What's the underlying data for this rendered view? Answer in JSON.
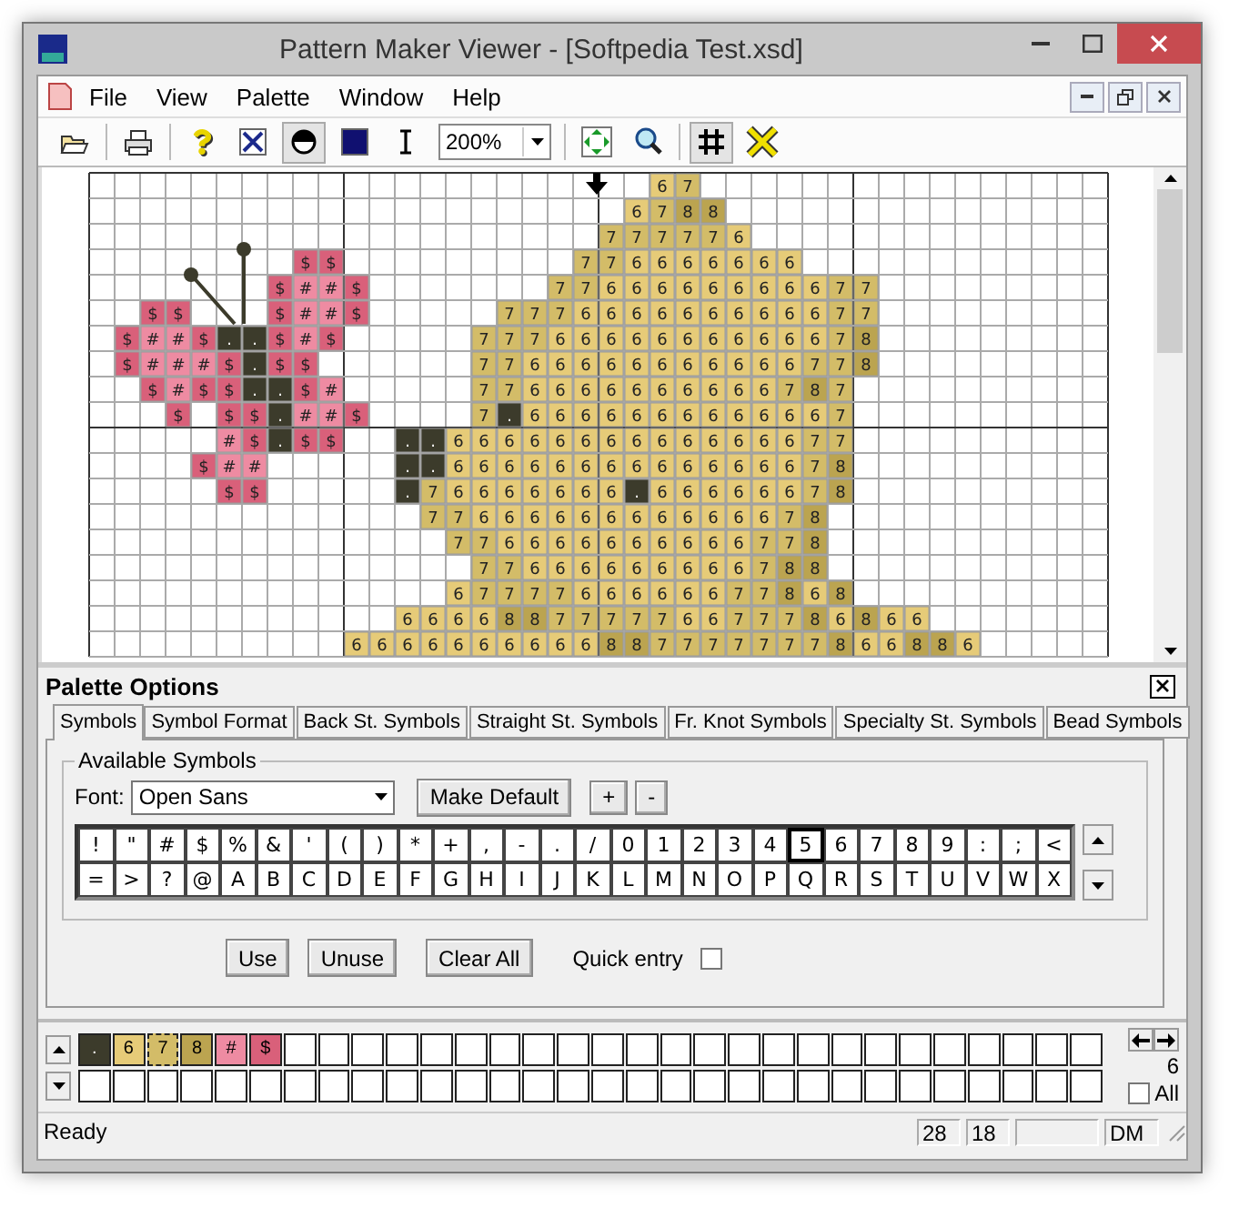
{
  "window": {
    "title": "Pattern Maker Viewer - [Softpedia Test.xsd]"
  },
  "menu": [
    "File",
    "View",
    "Palette",
    "Window",
    "Help"
  ],
  "toolbar": {
    "buttons": [
      {
        "pressed": false
      },
      {
        "pressed": false
      },
      {
        "pressed": false
      },
      {
        "pressed": false
      },
      {
        "pressed": true
      },
      {
        "pressed": false
      },
      {
        "pressed": false
      },
      {
        "pressed": false
      },
      {
        "pressed": false
      },
      {
        "pressed": true
      },
      {
        "pressed": false
      }
    ],
    "zoom": "200%"
  },
  "pattern": {
    "rows": [
      [
        null,
        null,
        null,
        null,
        null,
        null,
        null,
        null,
        null,
        null,
        null,
        null,
        null,
        null,
        null,
        null,
        null,
        null,
        null,
        null,
        null,
        null,
        "6",
        "7"
      ],
      [
        null,
        null,
        null,
        null,
        null,
        null,
        null,
        null,
        null,
        null,
        null,
        null,
        null,
        null,
        null,
        null,
        null,
        null,
        null,
        null,
        null,
        "6",
        "7",
        "8",
        "8"
      ],
      [
        null,
        null,
        null,
        null,
        null,
        null,
        null,
        null,
        null,
        null,
        null,
        null,
        null,
        null,
        null,
        null,
        null,
        null,
        null,
        null,
        "7",
        "7",
        "7",
        "7",
        "7",
        "6"
      ],
      [
        null,
        null,
        null,
        null,
        null,
        null,
        null,
        null,
        "$",
        "$",
        null,
        null,
        null,
        null,
        null,
        null,
        null,
        null,
        null,
        "7",
        "7",
        "6",
        "6",
        "6",
        "6",
        "6",
        "6",
        "6"
      ],
      [
        null,
        null,
        null,
        null,
        null,
        null,
        null,
        "$",
        "#",
        "#",
        "$",
        null,
        null,
        null,
        null,
        null,
        null,
        null,
        "7",
        "7",
        "6",
        "6",
        "6",
        "6",
        "6",
        "6",
        "6",
        "6",
        "6",
        "7",
        "7"
      ],
      [
        null,
        null,
        "$",
        "$",
        null,
        null,
        null,
        "$",
        "#",
        "#",
        "$",
        null,
        null,
        null,
        null,
        null,
        "7",
        "7",
        "7",
        "6",
        "6",
        "6",
        "6",
        "6",
        "6",
        "6",
        "6",
        "6",
        "6",
        "7",
        "7"
      ],
      [
        null,
        "$",
        "#",
        "#",
        "$",
        ".",
        ".",
        "$",
        "#",
        "$",
        null,
        null,
        null,
        null,
        null,
        "7",
        "7",
        "7",
        "6",
        "6",
        "6",
        "6",
        "6",
        "6",
        "6",
        "6",
        "6",
        "6",
        "6",
        "7",
        "8"
      ],
      [
        null,
        "$",
        "#",
        "#",
        "#",
        "$",
        ".",
        "$",
        "$",
        null,
        null,
        null,
        null,
        null,
        null,
        "7",
        "7",
        "6",
        "6",
        "6",
        "6",
        "6",
        "6",
        "6",
        "6",
        "6",
        "6",
        "6",
        "7",
        "7",
        "8"
      ],
      [
        null,
        null,
        "$",
        "#",
        "$",
        "$",
        ".",
        ".",
        "$",
        "#",
        null,
        null,
        null,
        null,
        null,
        "7",
        "7",
        "6",
        "6",
        "6",
        "6",
        "6",
        "6",
        "6",
        "6",
        "6",
        "6",
        "7",
        "8",
        "7"
      ],
      [
        null,
        null,
        null,
        "$",
        null,
        "$",
        "$",
        ".",
        "#",
        "#",
        "$",
        null,
        null,
        null,
        null,
        "7",
        ".",
        "6",
        "6",
        "6",
        "6",
        "6",
        "6",
        "6",
        "6",
        "6",
        "6",
        "6",
        "6",
        "7"
      ],
      [
        null,
        null,
        null,
        null,
        null,
        "#",
        "$",
        ".",
        "$",
        "$",
        null,
        null,
        ".",
        ".",
        "6",
        "6",
        "6",
        "6",
        "6",
        "6",
        "6",
        "6",
        "6",
        "6",
        "6",
        "6",
        "6",
        "6",
        "7",
        "7"
      ],
      [
        null,
        null,
        null,
        null,
        "$",
        "#",
        "#",
        null,
        null,
        null,
        null,
        null,
        ".",
        ".",
        "6",
        "6",
        "6",
        "6",
        "6",
        "6",
        "6",
        "6",
        "6",
        "6",
        "6",
        "6",
        "6",
        "6",
        "7",
        "8"
      ],
      [
        null,
        null,
        null,
        null,
        null,
        "$",
        "$",
        null,
        null,
        null,
        null,
        null,
        ".",
        "7",
        "6",
        "6",
        "6",
        "6",
        "6",
        "6",
        "6",
        ".",
        "6",
        "6",
        "6",
        "6",
        "6",
        "6",
        "7",
        "8"
      ],
      [
        null,
        null,
        null,
        null,
        null,
        null,
        null,
        null,
        null,
        null,
        null,
        null,
        null,
        "7",
        "7",
        "6",
        "6",
        "6",
        "6",
        "6",
        "6",
        "6",
        "6",
        "6",
        "6",
        "6",
        "6",
        "7",
        "8"
      ],
      [
        null,
        null,
        null,
        null,
        null,
        null,
        null,
        null,
        null,
        null,
        null,
        null,
        null,
        null,
        "7",
        "7",
        "6",
        "6",
        "6",
        "6",
        "6",
        "6",
        "6",
        "6",
        "6",
        "6",
        "7",
        "7",
        "8"
      ],
      [
        null,
        null,
        null,
        null,
        null,
        null,
        null,
        null,
        null,
        null,
        null,
        null,
        null,
        null,
        null,
        "7",
        "7",
        "6",
        "6",
        "6",
        "6",
        "6",
        "6",
        "6",
        "6",
        "6",
        "7",
        "8",
        "8"
      ],
      [
        null,
        null,
        null,
        null,
        null,
        null,
        null,
        null,
        null,
        null,
        null,
        null,
        null,
        null,
        "6",
        "7",
        "7",
        "7",
        "7",
        "6",
        "6",
        "6",
        "6",
        "6",
        "6",
        "7",
        "7",
        "8",
        "6",
        "8"
      ],
      [
        null,
        null,
        null,
        null,
        null,
        null,
        null,
        null,
        null,
        null,
        null,
        null,
        "6",
        "6",
        "6",
        "6",
        "8",
        "8",
        "7",
        "7",
        "7",
        "7",
        "7",
        "6",
        "6",
        "7",
        "7",
        "7",
        "8",
        "6",
        "8",
        "6",
        "6"
      ],
      [
        null,
        null,
        null,
        null,
        null,
        null,
        null,
        null,
        null,
        null,
        "6",
        "6",
        "6",
        "6",
        "6",
        "6",
        "6",
        "6",
        "6",
        "6",
        "8",
        "8",
        "7",
        "7",
        "7",
        "7",
        "7",
        "7",
        "7",
        "8",
        "6",
        "6",
        "8",
        "8",
        "6"
      ]
    ]
  },
  "palette_options": {
    "title": "Palette Options",
    "tabs": [
      {
        "label": "Symbols",
        "selected": true
      },
      {
        "label": "Symbol Format",
        "selected": false
      },
      {
        "label": "Back St. Symbols",
        "selected": false
      },
      {
        "label": "Straight St. Symbols",
        "selected": false
      },
      {
        "label": "Fr. Knot Symbols",
        "selected": false
      },
      {
        "label": "Specialty St. Symbols",
        "selected": false
      },
      {
        "label": "Bead Symbols",
        "selected": false
      }
    ],
    "group_title": "Available Symbols",
    "font_label": "Font:",
    "font_value": "Open Sans",
    "make_default": "Make Default",
    "size_buttons": [
      "+",
      "-"
    ],
    "symbols": [
      [
        {
          "s": "!",
          "selected": false
        },
        {
          "s": "\"",
          "selected": false
        },
        {
          "s": "#",
          "selected": false
        },
        {
          "s": "$",
          "selected": false
        },
        {
          "s": "%",
          "selected": false
        },
        {
          "s": "&",
          "selected": false
        },
        {
          "s": "'",
          "selected": false
        },
        {
          "s": "(",
          "selected": false
        },
        {
          "s": ")",
          "selected": false
        },
        {
          "s": "*",
          "selected": false
        },
        {
          "s": "+",
          "selected": false
        },
        {
          "s": ",",
          "selected": false
        },
        {
          "s": "-",
          "selected": false
        },
        {
          "s": ".",
          "selected": false
        },
        {
          "s": "/",
          "selected": false
        },
        {
          "s": "0",
          "selected": false
        },
        {
          "s": "1",
          "selected": false
        },
        {
          "s": "2",
          "selected": false
        },
        {
          "s": "3",
          "selected": false
        },
        {
          "s": "4",
          "selected": false
        },
        {
          "s": "5",
          "selected": true
        },
        {
          "s": "6",
          "selected": false
        },
        {
          "s": "7",
          "selected": false
        },
        {
          "s": "8",
          "selected": false
        },
        {
          "s": "9",
          "selected": false
        },
        {
          "s": ":",
          "selected": false
        },
        {
          "s": ";",
          "selected": false
        },
        {
          "s": "<",
          "selected": false
        }
      ],
      [
        {
          "s": "=",
          "selected": false
        },
        {
          "s": ">",
          "selected": false
        },
        {
          "s": "?",
          "selected": false
        },
        {
          "s": "@",
          "selected": false
        },
        {
          "s": "A",
          "selected": false
        },
        {
          "s": "B",
          "selected": false
        },
        {
          "s": "C",
          "selected": false
        },
        {
          "s": "D",
          "selected": false
        },
        {
          "s": "E",
          "selected": false
        },
        {
          "s": "F",
          "selected": false
        },
        {
          "s": "G",
          "selected": false
        },
        {
          "s": "H",
          "selected": false
        },
        {
          "s": "I",
          "selected": false
        },
        {
          "s": "J",
          "selected": false
        },
        {
          "s": "K",
          "selected": false
        },
        {
          "s": "L",
          "selected": false
        },
        {
          "s": "M",
          "selected": false
        },
        {
          "s": "N",
          "selected": false
        },
        {
          "s": "O",
          "selected": false
        },
        {
          "s": "P",
          "selected": false
        },
        {
          "s": "Q",
          "selected": false
        },
        {
          "s": "R",
          "selected": false
        },
        {
          "s": "S",
          "selected": false
        },
        {
          "s": "T",
          "selected": false
        },
        {
          "s": "U",
          "selected": false
        },
        {
          "s": "V",
          "selected": false
        },
        {
          "s": "W",
          "selected": false
        },
        {
          "s": "X",
          "selected": false
        }
      ]
    ],
    "actions": [
      "Use",
      "Unuse",
      "Clear All"
    ],
    "quick_entry": {
      "label": "Quick entry",
      "checked": false
    }
  },
  "palette": {
    "colors": [
      {
        "symbol": ".",
        "color": "#3c3b2b",
        "selected": false
      },
      {
        "symbol": "6",
        "color": "#e6cb78",
        "selected": false
      },
      {
        "symbol": "7",
        "color": "#d3bc68",
        "selected": true
      },
      {
        "symbol": "8",
        "color": "#bba450",
        "selected": false
      },
      {
        "symbol": "#",
        "color": "#ee8ba2",
        "selected": false
      },
      {
        "symbol": "$",
        "color": "#d9607a",
        "selected": false
      }
    ],
    "count": "6",
    "all": {
      "label": "All",
      "checked": false
    }
  },
  "status_bar": {
    "text": "Ready",
    "panes": [
      "28",
      "18",
      "DM"
    ]
  }
}
